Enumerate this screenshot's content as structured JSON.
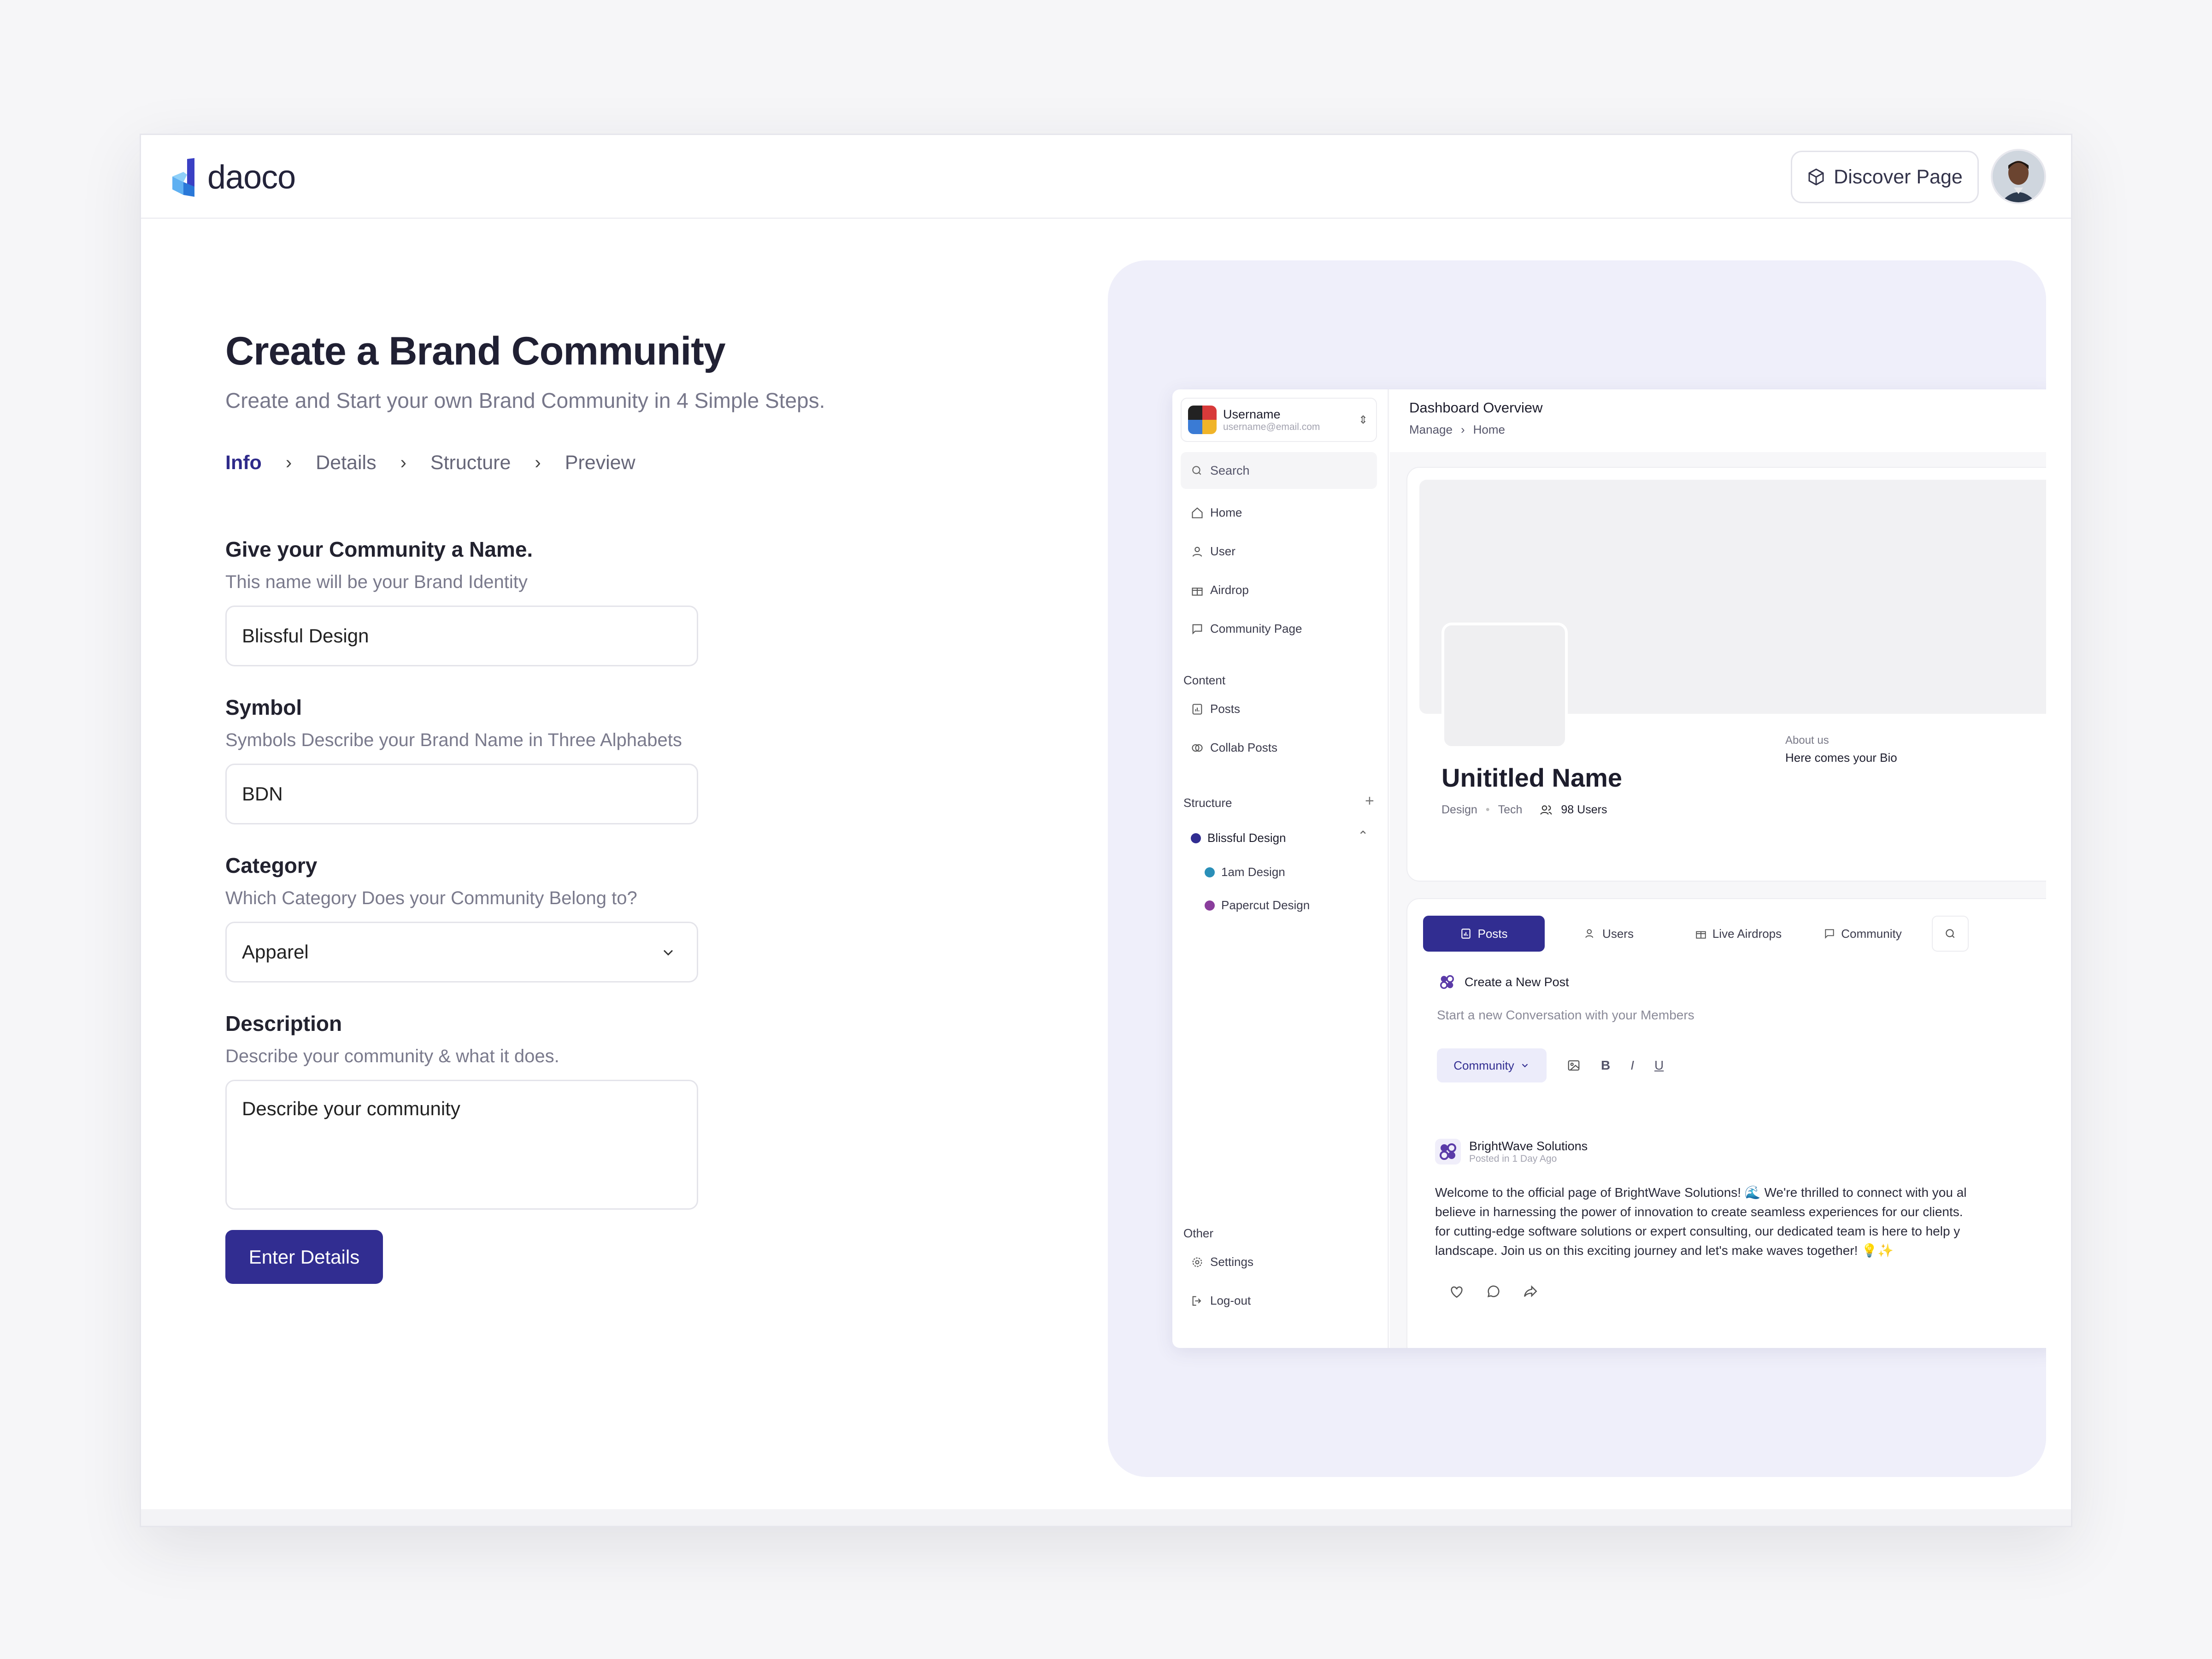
{
  "app": {
    "logo_text": "daoco",
    "discover_label": "Discover Page"
  },
  "form": {
    "title": "Create a Brand Community",
    "subtitle": "Create and Start your own Brand Community in 4 Simple Steps.",
    "steps": [
      "Info",
      "Details",
      "Structure",
      "Preview"
    ],
    "active_step": "Info",
    "name_label": "Give your Community a Name.",
    "name_help": "This name will be your Brand Identity",
    "name_value": "Blissful Design",
    "symbol_label": "Symbol",
    "symbol_help": "Symbols Describe your Brand Name in Three Alphabets",
    "symbol_value": "BDN",
    "category_label": "Category",
    "category_help": "Which Category Does your Community Belong to?",
    "category_value": "Apparel",
    "description_label": "Description",
    "description_help": "Describe your community & what it does.",
    "description_placeholder": "Describe your community",
    "submit_label": "Enter Details"
  },
  "preview": {
    "user": {
      "name": "Username",
      "email": "username@email.com"
    },
    "search_placeholder": "Search",
    "nav": [
      "Home",
      "User",
      "Airdrop",
      "Community Page"
    ],
    "content_heading": "Content",
    "content_items": [
      "Posts",
      "Collab Posts"
    ],
    "structure_heading": "Structure",
    "structure_items": [
      {
        "name": "Blissful Design",
        "color": "#312d91"
      },
      {
        "name": "1am Design",
        "color": "#2a8fb8"
      },
      {
        "name": "Papercut Design",
        "color": "#8a3d9c"
      }
    ],
    "other_heading": "Other",
    "other_items": [
      "Settings",
      "Log-out"
    ],
    "header_title": "Dashboard Overview",
    "breadcrumb": [
      "Manage",
      "Home"
    ],
    "profile": {
      "name": "Unititled Name",
      "tags": [
        "Design",
        "Tech"
      ],
      "users": "98 Users",
      "about_label": "About us",
      "bio": "Here comes your Bio"
    },
    "tabs": [
      "Posts",
      "Users",
      "Live Airdrops",
      "Community"
    ],
    "compose": {
      "title": "Create a New Post",
      "placeholder": "Start a new Conversation with your Members",
      "audience": "Community"
    },
    "post": {
      "author": "BrightWave Solutions",
      "time": "Posted in 1 Day Ago",
      "lines": [
        "Welcome to the official page of BrightWave Solutions! 🌊 We're thrilled to connect with you al",
        "believe in harnessing the power of innovation to create seamless experiences for our clients.",
        "for cutting-edge software solutions or expert consulting, our dedicated team is here to help y",
        "landscape. Join us on this exciting journey and let's make waves together! 💡✨"
      ]
    }
  }
}
